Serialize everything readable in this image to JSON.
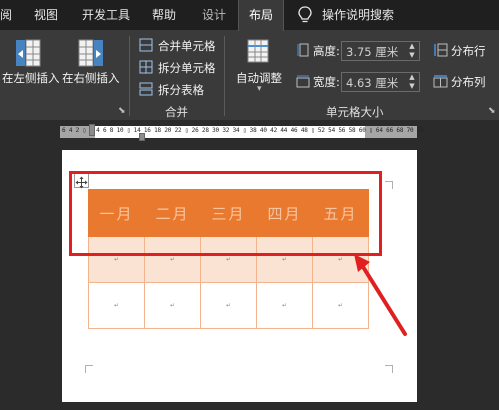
{
  "tabs": [
    {
      "label": "阅"
    },
    {
      "label": "视图"
    },
    {
      "label": "开发工具"
    },
    {
      "label": "帮助"
    },
    {
      "label": "设计"
    },
    {
      "label": "布局",
      "active": true
    },
    {
      "label": "操作说明搜索"
    }
  ],
  "ribbon": {
    "insert_left": "在左侧插入",
    "insert_right": "在右侧插入",
    "merge_cells": "合并单元格",
    "split_cells": "拆分单元格",
    "split_table": "拆分表格",
    "merge_group": "合并",
    "autofit": "自动调整",
    "height_label": "高度:",
    "height_value": "3.75 厘米",
    "width_label": "宽度:",
    "width_value": "4.63 厘米",
    "distribute_rows": "分布行",
    "distribute_cols": "分布列",
    "cell_size_group": "单元格大小"
  },
  "ruler": {
    "numbers": "6 4 2 ▯ 2 4 6 8 10 ▯ 14 16 18 20 22 ▯ 26 28 30 32 34 ▯ 38 40 42 44 46 48 ▯ 52 54 56 58 60 ▯ 64 66 68 70 72"
  },
  "table": {
    "headers": [
      "一月",
      "二月",
      "三月",
      "四月",
      "五月"
    ],
    "cell_mark": "↵"
  },
  "colors": {
    "header_fill": "#e8792f",
    "header_text": "#f6c5a0",
    "row_fill": "#fbe3d3",
    "highlight": "#e02020"
  },
  "icons": {
    "search": "lightbulb-icon",
    "move_table": "four-arrows-icon"
  }
}
